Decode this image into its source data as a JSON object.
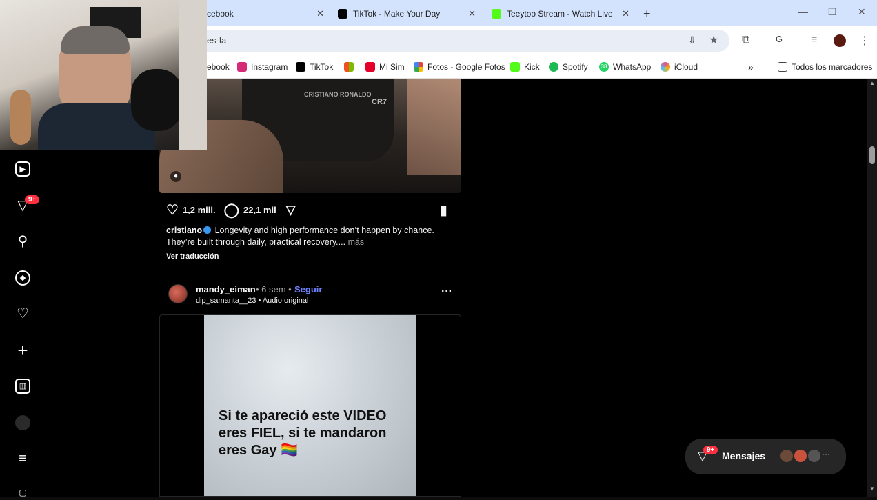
{
  "browser": {
    "tabs": [
      {
        "title": "cebook",
        "favicon_color": "#1877f2"
      },
      {
        "title": "TikTok - Make Your Day",
        "favicon_color": "#000000"
      },
      {
        "title": "Teeytoo Stream - Watch Live or",
        "favicon_color": "#53fc18"
      }
    ],
    "url_fragment": "es-la",
    "bookmarks": [
      {
        "label": "ebook",
        "color": "#1877f2"
      },
      {
        "label": "Instagram",
        "color": "#d62976"
      },
      {
        "label": "TikTok",
        "color": "#000000"
      },
      {
        "label": "",
        "color": "#f25022"
      },
      {
        "label": "Mi Sim",
        "color": "#e4002b"
      },
      {
        "label": "Fotos - Google Fotos",
        "color": "#fbbc04"
      },
      {
        "label": "Kick",
        "color": "#53fc18"
      },
      {
        "label": "Spotify",
        "color": "#1db954"
      },
      {
        "label": "WhatsApp",
        "color": "#25d366"
      },
      {
        "label": "iCloud",
        "color": "#e04f8f"
      }
    ],
    "whatsapp_badge": "38",
    "all_bookmarks": "Todos los marcadores"
  },
  "sidebar": {
    "notifications_badge": "9+"
  },
  "post1": {
    "likes": "1,2 mill.",
    "comments": "22,1 mil",
    "caption_user": "cristiano",
    "caption_line1": "Longevity and high performance don’t happen by chance.",
    "caption_line2": "They’re built through daily, practical recovery....",
    "more": "más",
    "translate": "Ver traducción",
    "shorts_text": "CR7"
  },
  "post2": {
    "user": "mandy_eiman",
    "time": "• 6 sem •",
    "follow": "Seguir",
    "audio_user": "dip_samanta__23",
    "audio_label": "• Audio original",
    "menu": "···",
    "video_text": "Si te apareció este VIDEO eres FIEL, si te mandaron eres Gay 🏳️‍🌈"
  },
  "messages": {
    "label": "Mensajes",
    "badge": "9+",
    "more": "···"
  },
  "colors": {
    "follow": "#6e82ff",
    "badge": "#ff3040",
    "verified": "#3897f0"
  }
}
